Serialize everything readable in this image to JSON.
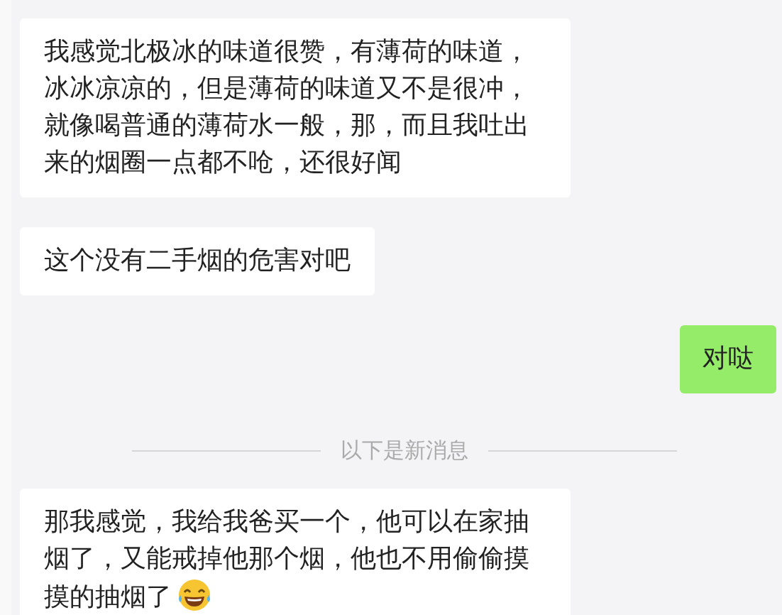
{
  "messages": [
    {
      "kind": "text",
      "outgoing": false,
      "text": "我感觉北极冰的味道很赞，有薄荷的味道，冰冰凉凉的，但是薄荷的味道又不是很冲，就像喝普通的薄荷水一般，那，而且我吐出来的烟圈一点都不呛，还很好闻"
    },
    {
      "kind": "text",
      "outgoing": false,
      "text": "这个没有二手烟的危害对吧"
    },
    {
      "kind": "text",
      "outgoing": true,
      "text": "对哒"
    },
    {
      "kind": "divider",
      "text": "以下是新消息"
    },
    {
      "kind": "text",
      "outgoing": false,
      "text": "那我感觉，我给我爸买一个，他可以在家抽烟了，又能戒掉他那个烟，他也不用偷偷摸摸的抽烟了",
      "trailing_emoji": true
    }
  ]
}
